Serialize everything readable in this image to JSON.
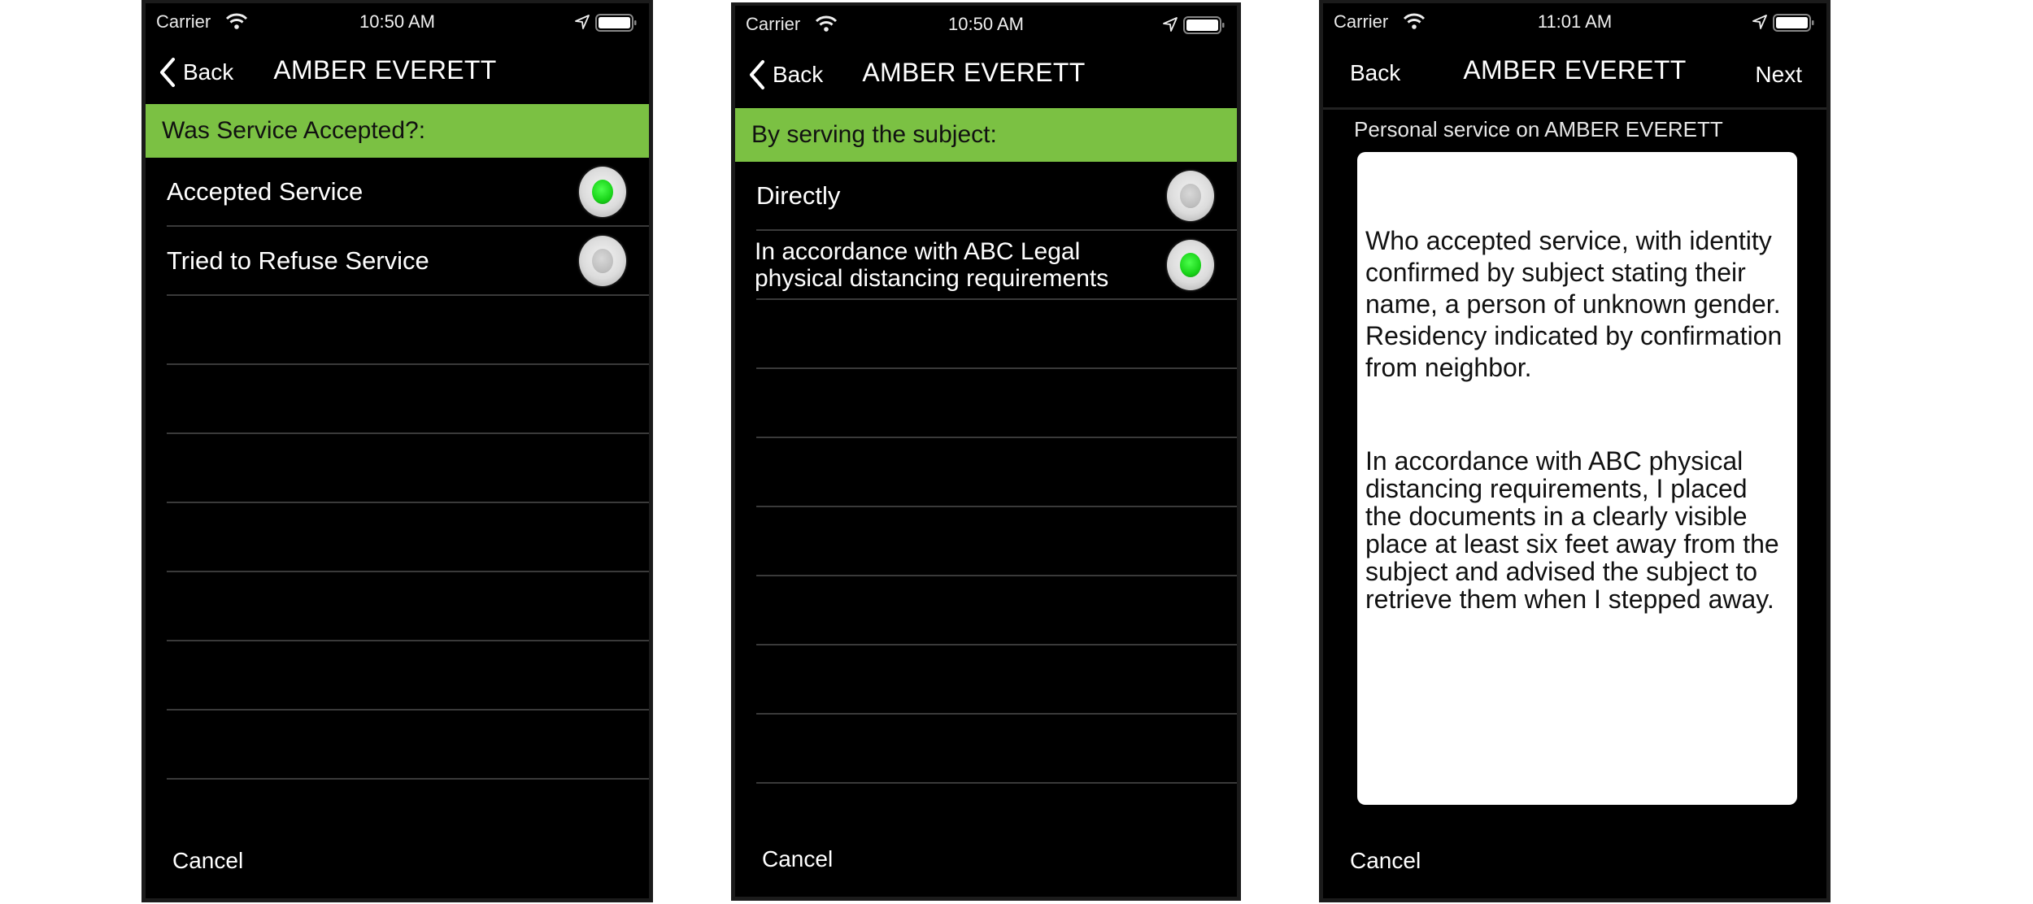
{
  "screens": [
    {
      "status": {
        "carrier": "Carrier",
        "time": "10:50 AM"
      },
      "nav": {
        "back_label": "Back",
        "title": "AMBER EVERETT"
      },
      "section_header": "Was Service Accepted?:",
      "options": [
        {
          "label": "Accepted Service",
          "selected": true
        },
        {
          "label": "Tried to Refuse Service",
          "selected": false
        }
      ],
      "cancel_label": "Cancel"
    },
    {
      "status": {
        "carrier": "Carrier",
        "time": "10:50 AM"
      },
      "nav": {
        "back_label": "Back",
        "title": "AMBER EVERETT"
      },
      "section_header": "By serving the subject:",
      "options": [
        {
          "label": "Directly",
          "selected": false
        },
        {
          "label": "In accordance with ABC Legal physical distancing requirements",
          "selected": true
        }
      ],
      "cancel_label": "Cancel"
    },
    {
      "status": {
        "carrier": "Carrier",
        "time": "11:01 AM"
      },
      "nav": {
        "back_label": "Back",
        "title": "AMBER EVERETT",
        "next_label": "Next"
      },
      "field_label": "Personal service on AMBER EVERETT",
      "notes": [
        "Who accepted service, with identity confirmed by subject stating their name, a person of unknown gender. Residency indicated by confirmation from neighbor.",
        "In accordance with ABC physical distancing requirements, I placed the documents in a clearly visible place at least six feet away from the subject and advised the subject to retrieve them when I stepped away."
      ],
      "cancel_label": "Cancel"
    }
  ],
  "colors": {
    "section_header_bg": "#7bc143",
    "radio_selected": "#19d419"
  }
}
